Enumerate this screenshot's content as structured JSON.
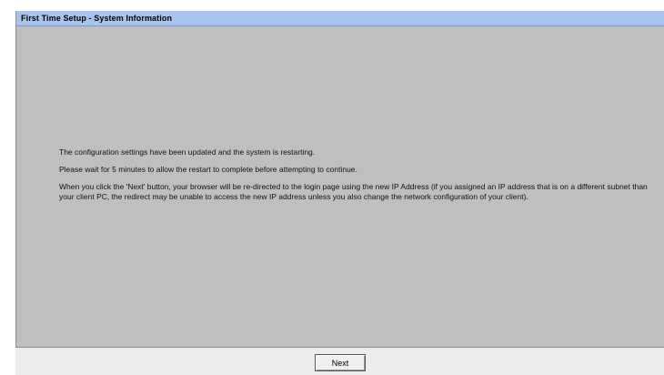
{
  "header": {
    "title": "First Time Setup - System Information"
  },
  "main": {
    "messages": [
      "The configuration settings have been updated and the system is restarting.",
      "Please wait for 5 minutes to allow the restart to complete before attempting to continue.",
      "When you click the 'Next' button, your browser will be re-directed to the login page using the new IP Address (if you assigned an IP address that is on a different subnet than your client PC, the redirect may be unable to access the new IP address unless you also change the network configuration of your client)."
    ]
  },
  "footer": {
    "next_label": "Next"
  },
  "colors": {
    "title_bar": "#a9c4ec",
    "panel_background": "#c0bfbf",
    "footer_background": "#ececec"
  }
}
